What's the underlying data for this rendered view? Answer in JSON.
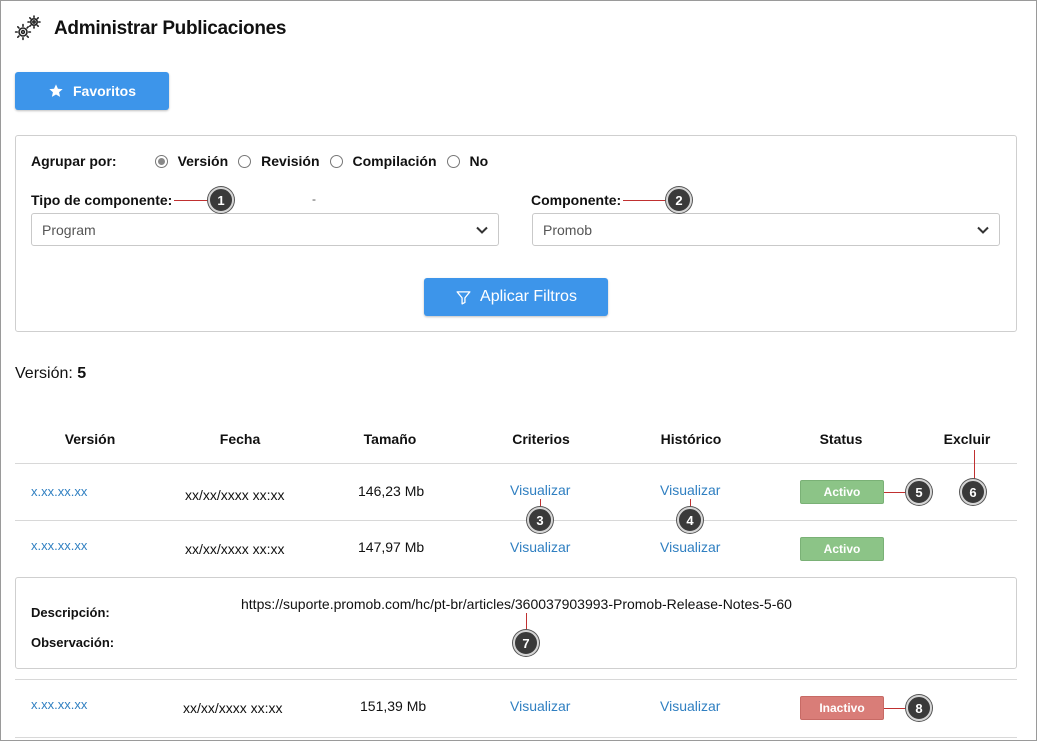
{
  "header": {
    "title": "Administrar Publicaciones",
    "icon": "gears-icon"
  },
  "favorites_button": {
    "label": "Favoritos",
    "icon": "star-icon"
  },
  "filters": {
    "group_by_label": "Agrupar por:",
    "group_options": [
      {
        "label": "Versión",
        "selected": true
      },
      {
        "label": "Revisión",
        "selected": false
      },
      {
        "label": "Compilación",
        "selected": false
      },
      {
        "label": "No",
        "selected": false
      }
    ],
    "component_type_label": "Tipo de componente:",
    "component_type_value": "Program",
    "stray_mark": "-",
    "component_label": "Componente:",
    "component_value": "Promob",
    "apply_label": "Aplicar Filtros"
  },
  "version_summary": {
    "label": "Versión:",
    "value": "5"
  },
  "table": {
    "headers": [
      "Versión",
      "Fecha",
      "Tamaño",
      "Criterios",
      "Histórico",
      "Status",
      "Excluir"
    ],
    "rows": [
      {
        "version": "x.xx.xx.xx",
        "date": "xx/xx/xxxx xx:xx",
        "size": "146,23 Mb",
        "criteria": "Visualizar",
        "history": "Visualizar",
        "status": "Activo"
      },
      {
        "version": "x.xx.xx.xx",
        "date": "xx/xx/xxxx xx:xx",
        "size": "147,97 Mb",
        "criteria": "Visualizar",
        "history": "Visualizar",
        "status": "Activo"
      },
      {
        "version": "x.xx.xx.xx",
        "date": "xx/xx/xxxx xx:xx",
        "size": "151,39 Mb",
        "criteria": "Visualizar",
        "history": "Visualizar",
        "status": "Inactivo"
      }
    ]
  },
  "detail": {
    "description_label": "Descripción:",
    "observation_label": "Observación:",
    "url": "https://suporte.promob.com/hc/pt-br/articles/360037903993-Promob-Release-Notes-5-60"
  },
  "markers": [
    "1",
    "2",
    "3",
    "4",
    "5",
    "6",
    "7",
    "8"
  ],
  "colors": {
    "primary": "#3d95ea",
    "link": "#2f7fc1",
    "active": "#8cc487",
    "inactive": "#d97d78",
    "marker_line": "#c03030"
  }
}
